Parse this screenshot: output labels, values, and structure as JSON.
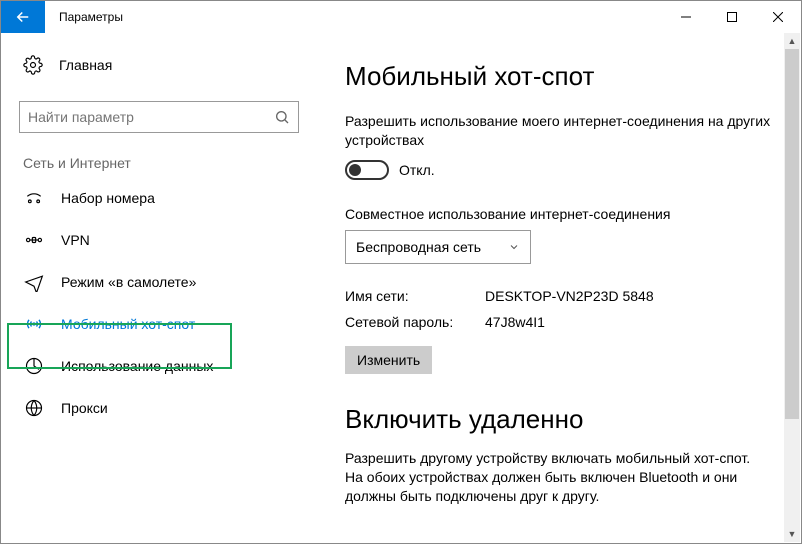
{
  "window": {
    "title": "Параметры"
  },
  "sidebar": {
    "home": "Главная",
    "search_placeholder": "Найти параметр",
    "category": "Сеть и Интернет",
    "items": [
      {
        "label": "Набор номера"
      },
      {
        "label": "VPN"
      },
      {
        "label": "Режим «в самолете»"
      },
      {
        "label": "Мобильный хот-спот"
      },
      {
        "label": "Использование данных"
      },
      {
        "label": "Прокси"
      }
    ]
  },
  "main": {
    "heading": "Мобильный хот-спот",
    "share_desc": "Разрешить использование моего интернет-соединения на других устройствах",
    "toggle_state": "Откл.",
    "share_from_label": "Совместное использование интернет-соединения",
    "share_from_value": "Беспроводная сеть",
    "net_name_label": "Имя сети:",
    "net_name_value": "DESKTOP-VN2P23D 5848",
    "net_pass_label": "Сетевой пароль:",
    "net_pass_value": "47J8w4I1",
    "change_btn": "Изменить",
    "remote_heading": "Включить удаленно",
    "remote_desc": "Разрешить другому устройству включать мобильный хот-спот. На обоих устройствах должен быть включен Bluetooth и они должны быть подключены друг к другу."
  }
}
